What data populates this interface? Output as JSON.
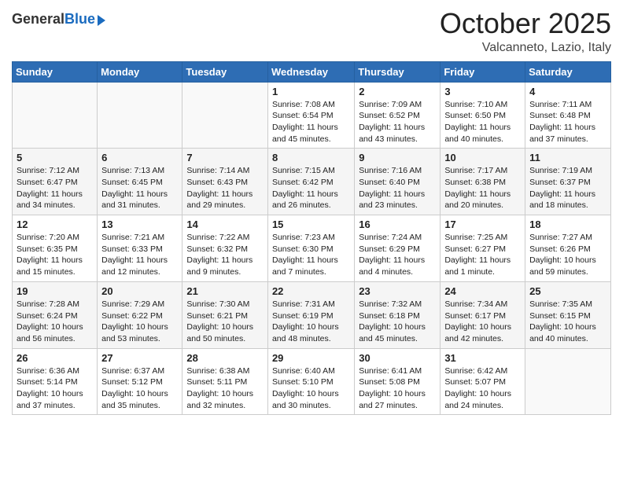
{
  "header": {
    "logo_general": "General",
    "logo_blue": "Blue",
    "month": "October 2025",
    "location": "Valcanneto, Lazio, Italy"
  },
  "days_of_week": [
    "Sunday",
    "Monday",
    "Tuesday",
    "Wednesday",
    "Thursday",
    "Friday",
    "Saturday"
  ],
  "weeks": [
    [
      {
        "day": "",
        "info": ""
      },
      {
        "day": "",
        "info": ""
      },
      {
        "day": "",
        "info": ""
      },
      {
        "day": "1",
        "info": "Sunrise: 7:08 AM\nSunset: 6:54 PM\nDaylight: 11 hours and 45 minutes."
      },
      {
        "day": "2",
        "info": "Sunrise: 7:09 AM\nSunset: 6:52 PM\nDaylight: 11 hours and 43 minutes."
      },
      {
        "day": "3",
        "info": "Sunrise: 7:10 AM\nSunset: 6:50 PM\nDaylight: 11 hours and 40 minutes."
      },
      {
        "day": "4",
        "info": "Sunrise: 7:11 AM\nSunset: 6:48 PM\nDaylight: 11 hours and 37 minutes."
      }
    ],
    [
      {
        "day": "5",
        "info": "Sunrise: 7:12 AM\nSunset: 6:47 PM\nDaylight: 11 hours and 34 minutes."
      },
      {
        "day": "6",
        "info": "Sunrise: 7:13 AM\nSunset: 6:45 PM\nDaylight: 11 hours and 31 minutes."
      },
      {
        "day": "7",
        "info": "Sunrise: 7:14 AM\nSunset: 6:43 PM\nDaylight: 11 hours and 29 minutes."
      },
      {
        "day": "8",
        "info": "Sunrise: 7:15 AM\nSunset: 6:42 PM\nDaylight: 11 hours and 26 minutes."
      },
      {
        "day": "9",
        "info": "Sunrise: 7:16 AM\nSunset: 6:40 PM\nDaylight: 11 hours and 23 minutes."
      },
      {
        "day": "10",
        "info": "Sunrise: 7:17 AM\nSunset: 6:38 PM\nDaylight: 11 hours and 20 minutes."
      },
      {
        "day": "11",
        "info": "Sunrise: 7:19 AM\nSunset: 6:37 PM\nDaylight: 11 hours and 18 minutes."
      }
    ],
    [
      {
        "day": "12",
        "info": "Sunrise: 7:20 AM\nSunset: 6:35 PM\nDaylight: 11 hours and 15 minutes."
      },
      {
        "day": "13",
        "info": "Sunrise: 7:21 AM\nSunset: 6:33 PM\nDaylight: 11 hours and 12 minutes."
      },
      {
        "day": "14",
        "info": "Sunrise: 7:22 AM\nSunset: 6:32 PM\nDaylight: 11 hours and 9 minutes."
      },
      {
        "day": "15",
        "info": "Sunrise: 7:23 AM\nSunset: 6:30 PM\nDaylight: 11 hours and 7 minutes."
      },
      {
        "day": "16",
        "info": "Sunrise: 7:24 AM\nSunset: 6:29 PM\nDaylight: 11 hours and 4 minutes."
      },
      {
        "day": "17",
        "info": "Sunrise: 7:25 AM\nSunset: 6:27 PM\nDaylight: 11 hours and 1 minute."
      },
      {
        "day": "18",
        "info": "Sunrise: 7:27 AM\nSunset: 6:26 PM\nDaylight: 10 hours and 59 minutes."
      }
    ],
    [
      {
        "day": "19",
        "info": "Sunrise: 7:28 AM\nSunset: 6:24 PM\nDaylight: 10 hours and 56 minutes."
      },
      {
        "day": "20",
        "info": "Sunrise: 7:29 AM\nSunset: 6:22 PM\nDaylight: 10 hours and 53 minutes."
      },
      {
        "day": "21",
        "info": "Sunrise: 7:30 AM\nSunset: 6:21 PM\nDaylight: 10 hours and 50 minutes."
      },
      {
        "day": "22",
        "info": "Sunrise: 7:31 AM\nSunset: 6:19 PM\nDaylight: 10 hours and 48 minutes."
      },
      {
        "day": "23",
        "info": "Sunrise: 7:32 AM\nSunset: 6:18 PM\nDaylight: 10 hours and 45 minutes."
      },
      {
        "day": "24",
        "info": "Sunrise: 7:34 AM\nSunset: 6:17 PM\nDaylight: 10 hours and 42 minutes."
      },
      {
        "day": "25",
        "info": "Sunrise: 7:35 AM\nSunset: 6:15 PM\nDaylight: 10 hours and 40 minutes."
      }
    ],
    [
      {
        "day": "26",
        "info": "Sunrise: 6:36 AM\nSunset: 5:14 PM\nDaylight: 10 hours and 37 minutes."
      },
      {
        "day": "27",
        "info": "Sunrise: 6:37 AM\nSunset: 5:12 PM\nDaylight: 10 hours and 35 minutes."
      },
      {
        "day": "28",
        "info": "Sunrise: 6:38 AM\nSunset: 5:11 PM\nDaylight: 10 hours and 32 minutes."
      },
      {
        "day": "29",
        "info": "Sunrise: 6:40 AM\nSunset: 5:10 PM\nDaylight: 10 hours and 30 minutes."
      },
      {
        "day": "30",
        "info": "Sunrise: 6:41 AM\nSunset: 5:08 PM\nDaylight: 10 hours and 27 minutes."
      },
      {
        "day": "31",
        "info": "Sunrise: 6:42 AM\nSunset: 5:07 PM\nDaylight: 10 hours and 24 minutes."
      },
      {
        "day": "",
        "info": ""
      }
    ]
  ]
}
